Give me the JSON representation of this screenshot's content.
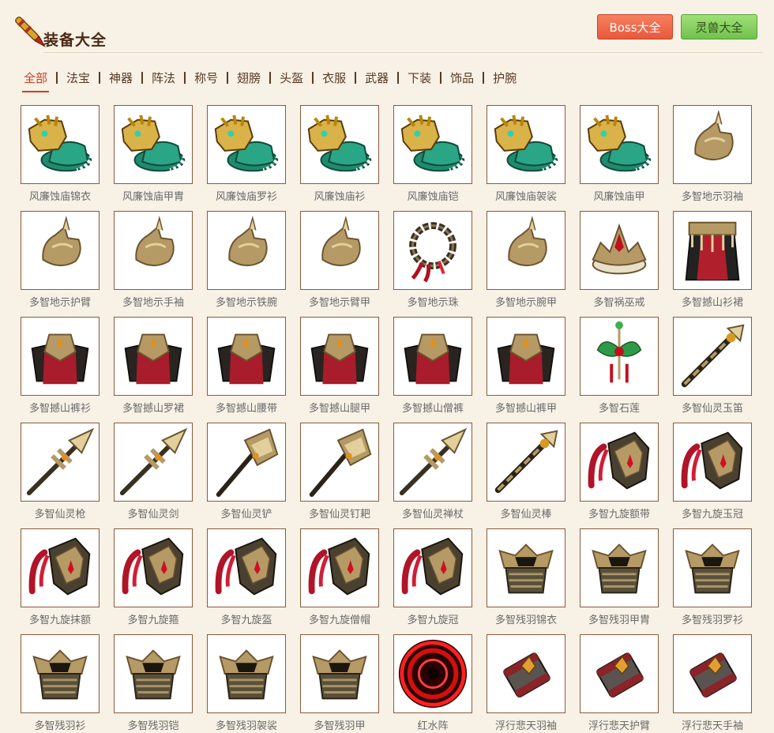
{
  "header": {
    "title": "装备大全",
    "boss_button": "Boss大全",
    "beast_button": "灵兽大全"
  },
  "tabs": [
    "全部",
    "法宝",
    "神器",
    "阵法",
    "称号",
    "翅膀",
    "头盔",
    "衣服",
    "武器",
    "下装",
    "饰品",
    "护腕"
  ],
  "active_tab": 0,
  "items": [
    {
      "name": "风廉蚀庙锦衣",
      "icon": "dragon-armor"
    },
    {
      "name": "风廉蚀庙甲胄",
      "icon": "dragon-armor"
    },
    {
      "name": "风廉蚀庙罗衫",
      "icon": "dragon-armor"
    },
    {
      "name": "风廉蚀庙衫",
      "icon": "dragon-armor"
    },
    {
      "name": "风廉蚀庙铠",
      "icon": "dragon-armor"
    },
    {
      "name": "风廉蚀庙袈裟",
      "icon": "dragon-armor"
    },
    {
      "name": "风廉蚀庙甲",
      "icon": "dragon-armor"
    },
    {
      "name": "多智地示羽袖",
      "icon": "gauntlet"
    },
    {
      "name": "多智地示护臂",
      "icon": "gauntlet"
    },
    {
      "name": "多智地示手袖",
      "icon": "gauntlet"
    },
    {
      "name": "多智地示铁腕",
      "icon": "gauntlet"
    },
    {
      "name": "多智地示臂甲",
      "icon": "gauntlet"
    },
    {
      "name": "多智地示珠",
      "icon": "prayer-beads"
    },
    {
      "name": "多智地示腕甲",
      "icon": "gauntlet"
    },
    {
      "name": "多智祸巫戒",
      "icon": "crown-ring"
    },
    {
      "name": "多智撼山衫裙",
      "icon": "robe"
    },
    {
      "name": "多智撼山裤衫",
      "icon": "skirt-armor"
    },
    {
      "name": "多智撼山罗裙",
      "icon": "skirt-armor"
    },
    {
      "name": "多智撼山腰带",
      "icon": "skirt-armor"
    },
    {
      "name": "多智撼山腿甲",
      "icon": "skirt-armor"
    },
    {
      "name": "多智撼山僧裤",
      "icon": "skirt-armor"
    },
    {
      "name": "多智撼山裤甲",
      "icon": "skirt-armor"
    },
    {
      "name": "多智石莲",
      "icon": "lotus-pendant"
    },
    {
      "name": "多智仙灵玉笛",
      "icon": "staff"
    },
    {
      "name": "多智仙灵枪",
      "icon": "spear"
    },
    {
      "name": "多智仙灵剑",
      "icon": "spear"
    },
    {
      "name": "多智仙灵铲",
      "icon": "shovel"
    },
    {
      "name": "多智仙灵钉耙",
      "icon": "shovel"
    },
    {
      "name": "多智仙灵禅杖",
      "icon": "spear"
    },
    {
      "name": "多智仙灵棒",
      "icon": "staff"
    },
    {
      "name": "多智九旋额带",
      "icon": "plume-helm"
    },
    {
      "name": "多智九旋玉冠",
      "icon": "plume-helm"
    },
    {
      "name": "多智九旋抹额",
      "icon": "plume-helm"
    },
    {
      "name": "多智九旋箍",
      "icon": "plume-helm"
    },
    {
      "name": "多智九旋盔",
      "icon": "plume-helm"
    },
    {
      "name": "多智九旋僧帽",
      "icon": "plume-helm"
    },
    {
      "name": "多智九旋冠",
      "icon": "plume-helm"
    },
    {
      "name": "多智残羽锦衣",
      "icon": "bone-armor"
    },
    {
      "name": "多智残羽甲胄",
      "icon": "bone-armor"
    },
    {
      "name": "多智残羽罗衫",
      "icon": "bone-armor"
    },
    {
      "name": "多智残羽衫",
      "icon": "bone-armor"
    },
    {
      "name": "多智残羽铠",
      "icon": "bone-armor"
    },
    {
      "name": "多智残羽袈裟",
      "icon": "bone-armor"
    },
    {
      "name": "多智残羽甲",
      "icon": "bone-armor"
    },
    {
      "name": "红水阵",
      "icon": "red-formation"
    },
    {
      "name": "浮行悲天羽袖",
      "icon": "bracer"
    },
    {
      "name": "浮行悲天护臂",
      "icon": "bracer"
    },
    {
      "name": "浮行悲天手袖",
      "icon": "bracer"
    }
  ],
  "colors": {
    "accent": "#d23a1f",
    "boss_button": "#e8593b",
    "beast_button": "#72c24c",
    "background": "#f7f1e6"
  }
}
